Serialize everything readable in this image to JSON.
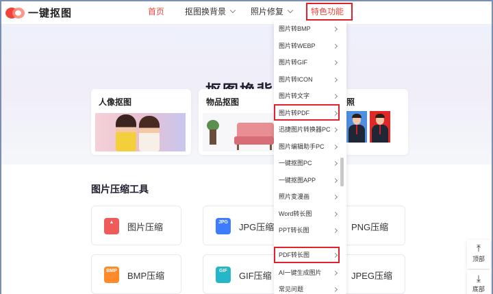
{
  "brand": {
    "name": "一键抠图",
    "logo_color": "#f0443d"
  },
  "nav": {
    "home": "首页",
    "bg_change": "抠图换背景",
    "photo_fix": "照片修复",
    "special": "特色功能"
  },
  "hero": {
    "title": "抠图换背",
    "cards": [
      {
        "title": "人像抠图"
      },
      {
        "title": "物品抠图"
      },
      {
        "title": "照"
      }
    ]
  },
  "dropdown": {
    "items": [
      "图片转BMP",
      "图片转WEBP",
      "图片转GIF",
      "图片转ICON",
      "图片转文字",
      "图片转PDF",
      "迅捷图片转换器PC",
      "图片编辑助手PC",
      "一键抠图PC",
      "一键抠图APP",
      "照片变漫画",
      "Word转长图",
      "PPT转长图",
      "PDF转长图",
      "AI一键生成图片",
      "常见问题"
    ]
  },
  "tools": {
    "title": "图片压缩工具",
    "items": [
      {
        "label": "图片压缩",
        "icon": "image-compress-icon",
        "color": "#ef5a5a"
      },
      {
        "label": "JPG压缩",
        "icon_text": "JPG",
        "color": "#3d7bff"
      },
      {
        "label": "PNG压缩"
      },
      {
        "label": "BMP压缩",
        "icon_text": "BMP",
        "color": "#ff8a2b"
      },
      {
        "label": "GIF压缩",
        "icon_text": "GIF",
        "color": "#25b6c9"
      },
      {
        "label": "JPEG压缩"
      }
    ]
  },
  "side": {
    "top": "顶部",
    "bottom": "底部"
  },
  "colors": {
    "accent": "#f0443d",
    "highlight_box": "#e0202c"
  }
}
